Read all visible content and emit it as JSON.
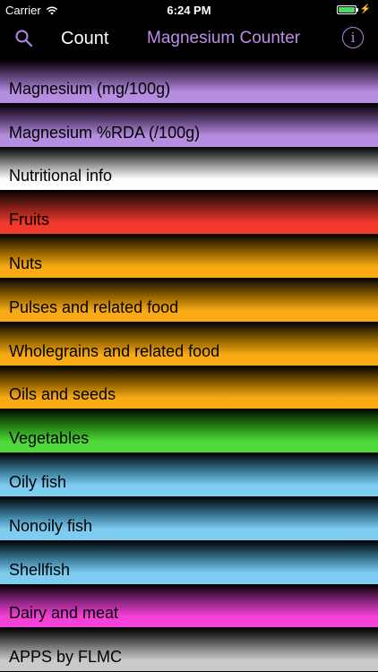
{
  "status": {
    "carrier": "Carrier",
    "time": "6:24 PM",
    "battery_level": 1.0,
    "battery_color": "#4cd964"
  },
  "nav": {
    "left_icon": "search-icon",
    "count_label": "Count",
    "title": "Magnesium Counter",
    "title_color": "#c08ce8",
    "right_icon": "info-icon",
    "info_glyph": "i"
  },
  "list": {
    "items": [
      {
        "label": "Magnesium (mg/100g)",
        "color": "purple"
      },
      {
        "label": "Magnesium %RDA (/100g)",
        "color": "purple"
      },
      {
        "label": "Nutritional info",
        "color": "white"
      },
      {
        "label": "Fruits",
        "color": "red"
      },
      {
        "label": "Nuts",
        "color": "orange"
      },
      {
        "label": "Pulses and related food",
        "color": "orange"
      },
      {
        "label": "Wholegrains and related food",
        "color": "orange"
      },
      {
        "label": "Oils and seeds",
        "color": "orange"
      },
      {
        "label": "Vegetables",
        "color": "green"
      },
      {
        "label": "Oily fish",
        "color": "blue"
      },
      {
        "label": "Nonoily fish",
        "color": "blue"
      },
      {
        "label": "Shellfish",
        "color": "blue"
      },
      {
        "label": "Dairy and meat",
        "color": "pink"
      },
      {
        "label": "APPS by FLMC",
        "color": "gray"
      }
    ]
  }
}
